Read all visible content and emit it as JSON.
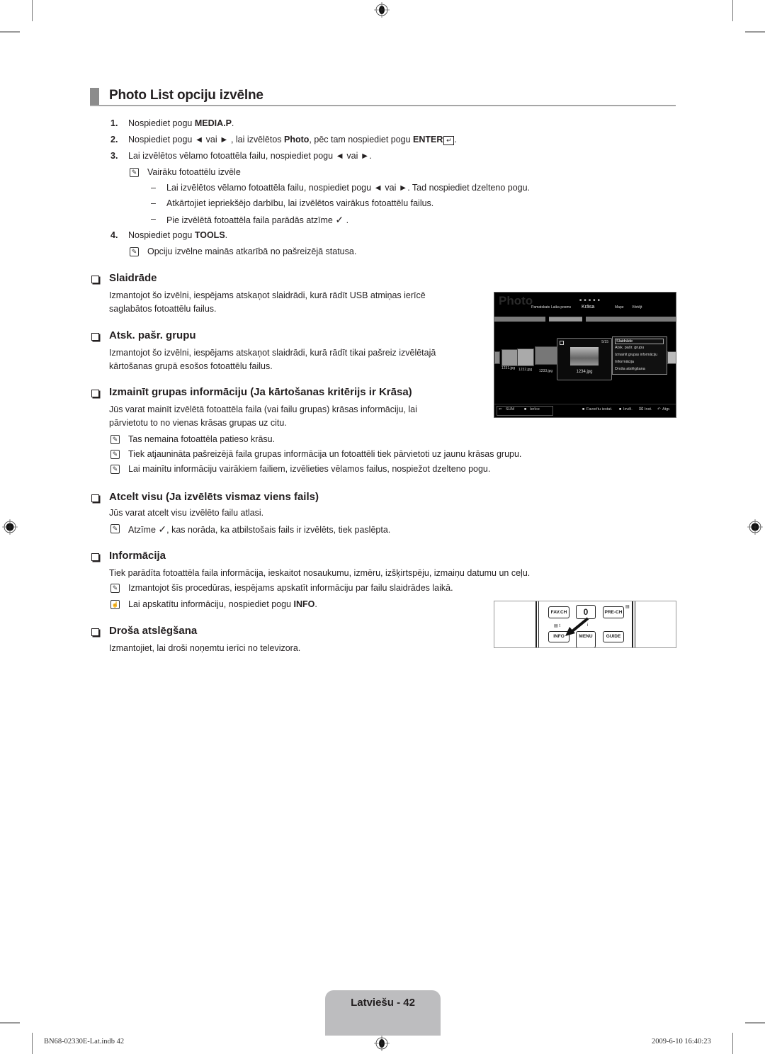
{
  "page": {
    "title": "Photo List opciju izvēlne",
    "steps": [
      {
        "num": "1.",
        "pre": "Nospiediet pogu ",
        "bold": "MEDIA.P",
        "post": "."
      },
      {
        "num": "2.",
        "pre": "Nospiediet pogu ◄ vai ► , lai izvēlētos ",
        "bold": "Photo",
        "mid": ", pēc tam nospiediet pogu ",
        "bold2": "ENTER",
        "post": "."
      },
      {
        "num": "3.",
        "text": "Lai izvēlētos vēlamo fotoattēla failu, nospiediet pogu ◄ vai ►."
      },
      {
        "num": "4.",
        "pre": "Nospiediet pogu ",
        "bold": "TOOLS",
        "post": "."
      }
    ],
    "step3_note": "Vairāku fotoattēlu izvēle",
    "step3_dashes": [
      "Lai izvēlētos vēlamo fotoattēla failu, nospiediet pogu ◄ vai ►. Tad nospiediet dzelteno pogu.",
      "Atkārtojiet iepriekšējo darbību, lai izvēlētos vairākus fotoattēlu failus.",
      "Pie izvēlētā fotoattēla faila parādās atzīme"
    ],
    "step3_dash3_suffix": ".",
    "step4_note": "Opciju izvēlne mainās atkarībā no pašreizējā statusa.",
    "dash": "–",
    "check_glyph": "✓"
  },
  "sections": {
    "slaidrade": {
      "heading": "Slaidrāde",
      "lines": [
        "Izmantojot šo izvēlni, iespējams atskaņot slaidrādi, kurā rādīt USB atmiņas ierīcē",
        "saglabātos fotoattēlu failus."
      ]
    },
    "atsk": {
      "heading": "Atsk. pašr. grupu",
      "lines": [
        "Izmantojot šo izvēlni, iespējams atskaņot slaidrādi, kurā rādīt tikai pašreiz izvēlētajā",
        "kārtošanas grupā esošos fotoattēlu failus."
      ]
    },
    "izmainit": {
      "heading": "Izmainīt grupas informāciju (Ja kārtošanas kritērijs ir Krāsa)",
      "lines": [
        "Jūs varat mainīt izvēlētā fotoattēla faila (vai failu grupas) krāsas informāciju, lai",
        "pārvietotu to no vienas krāsas grupas uz citu."
      ],
      "notes": [
        "Tas nemaina fotoattēla patieso krāsu.",
        "Tiek atjaunināta pašreizējā faila grupas informācija un fotoattēli tiek pārvietoti uz jaunu krāsas grupu.",
        "Lai mainītu informāciju vairākiem failiem, izvēlieties vēlamos failus, nospiežot dzelteno pogu."
      ]
    },
    "atcelt": {
      "heading": "Atcelt visu (Ja izvēlēts vismaz viens fails)",
      "line": "Jūs varat atcelt visu izvēlēto failu atlasi.",
      "note_pre": "Atzīme",
      "note_post": ", kas norāda, ka atbilstošais fails ir izvēlēts, tiek paslēpta."
    },
    "info": {
      "heading": "Informācija",
      "line": "Tiek parādīta fotoattēla faila informācija, ieskaitot nosaukumu, izmēru, izšķirtspēju, izmaiņu datumu un ceļu.",
      "note": "Izmantojot šīs procedūras, iespējams apskatīt informāciju par failu slaidrādes laikā.",
      "remote_note_pre": "Lai apskatītu informāciju, nospiediet pogu ",
      "remote_note_bold": "INFO",
      "remote_note_post": "."
    },
    "drosa": {
      "heading": "Droša atslēgšana",
      "line": "Izmantojiet, lai droši noņemtu ierīci no televizora."
    }
  },
  "tv_screen": {
    "title": "Photo",
    "tabs": [
      "Pamatskats",
      "Laika posms",
      "Krāsa",
      "Mape",
      "Vērtējt"
    ],
    "selected_tab": "Krāsa",
    "thumbnails": [
      "1231.jpg",
      "1232.jpg",
      "1233.jpg"
    ],
    "preview": {
      "counter": "5/15",
      "filename": "1234.jpg"
    },
    "menu_items": [
      "Slaidrāde",
      "Atsk. pašr. grupu",
      "Izmainīt grupas informāciju",
      "Informācija",
      "Droša atslēgšana"
    ],
    "selected_menu_item": "Slaidrāde",
    "footer_left": [
      "SUM",
      "Ierīce"
    ],
    "footer_right": [
      "Favorītu iestat.",
      "Izvēl.",
      "Inst.",
      "Atgr."
    ]
  },
  "remote": {
    "buttons": [
      "FAV.CH",
      "0",
      "PRE-CH",
      "INFO",
      "MENU",
      "GUIDE"
    ]
  },
  "footer": {
    "page_label": "Latviešu - 42",
    "slug_left": "BN68-02330E-Lat.indb   42",
    "slug_right": "2009-6-10   16:40:23"
  }
}
